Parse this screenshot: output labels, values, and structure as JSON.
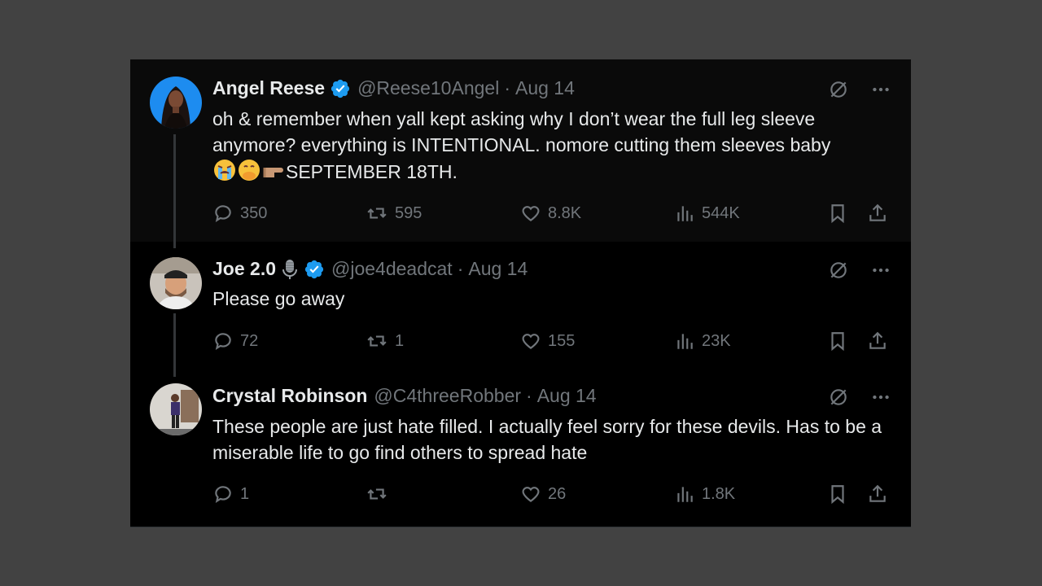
{
  "tweets": [
    {
      "name": "Angel Reese",
      "handle": "@Reese10Angel",
      "date": "Aug 14",
      "text": "oh & remember when yall kept asking why I don’t wear the full leg sleeve anymore? everything is INTENTIONAL. nomore cutting them sleeves baby",
      "text_tail": "SEPTEMBER 18TH.",
      "replies": "350",
      "reposts": "595",
      "likes": "8.8K",
      "views": "544K"
    },
    {
      "name": "Joe 2.0",
      "handle": "@joe4deadcat",
      "date": "Aug 14",
      "text": "Please go away",
      "replies": "72",
      "reposts": "1",
      "likes": "155",
      "views": "23K"
    },
    {
      "name": "Crystal Robinson",
      "handle": "@C4threeRobber",
      "date": "Aug 14",
      "text": "These people are just hate filled. I actually feel sorry for these devils. Has to be a miserable life to go find others to spread hate",
      "replies": "1",
      "reposts": "",
      "likes": "26",
      "views": "1.8K"
    }
  ],
  "separator": "·",
  "colors": {
    "background": "#424242",
    "panel": "#000000",
    "text": "#e7e9ea",
    "muted": "#71767b",
    "verified": "#1d9bf0"
  },
  "icons": [
    "verified-badge-icon",
    "microphone-icon",
    "grok-icon",
    "more-icon",
    "reply-icon",
    "repost-icon",
    "like-icon",
    "views-icon",
    "bookmark-icon",
    "share-icon"
  ]
}
